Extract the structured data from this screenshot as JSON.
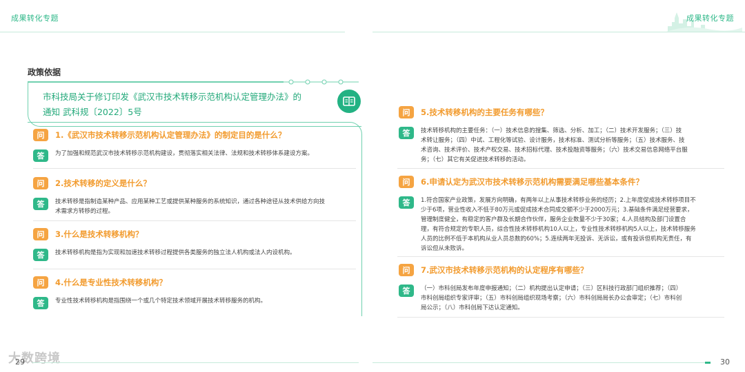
{
  "header": {
    "left_title": "成果转化专题",
    "right_title": "成果转化专题"
  },
  "section_title": "政策依据",
  "policy_title_lines": [
    "市科技局关于修订印发《武汉市技术转移示范机构认定管理办法》的",
    "通知 武科规〔2022〕5号"
  ],
  "badges": {
    "question": "问",
    "answer": "答"
  },
  "left_qa": [
    {
      "q": "1.《武汉市技术转移示范机构认定管理办法》的制定目的是什么？",
      "a": [
        "为了加强和规范武汉市技术转移示范机构建设，贯彻落实相关法律、法规和技术转移体系建设方案。"
      ]
    },
    {
      "q": "2.技术转移的定义是什么？",
      "a": [
        "技术转移是指制造某种产品、应用某种工艺或提供某种服务的系统知识，通过各种途径从技术供给方向技",
        "术需求方转移的过程。"
      ]
    },
    {
      "q": "3.什么是技术转移机构？",
      "a": [
        "技术转移机构是指为实现和加速技术转移过程提供各类服务的独立法人机构或法人内设机构。"
      ]
    },
    {
      "q": "4.什么是专业性技术转移机构？",
      "a": [
        "专业性技术转移机构是指围绕一个或几个特定技术领域开展技术转移服务的机构。"
      ]
    }
  ],
  "right_qa": [
    {
      "q": "5.技术转移机构的主要任务有哪些？",
      "a": [
        "技术转移机构的主要任务：（一）技术信息的搜集、筛选、分析、加工；（二）技术开发服务；（三）技",
        "术转让服务；（四）中试、工程化等试验、设计服务，技术标准、测试分析等服务；（五）技术服务、技",
        "术咨询、技术评价、技术产权交易、技术招标代理、技术投融资等服务；（六）技术交易信息网络平台服",
        "务；（七）其它有关促进技术转移的活动。"
      ]
    },
    {
      "q": "6.申请认定为武汉市技术转移示范机构需要满足哪些基本条件？",
      "a": [
        "1.符合国家产业政策，发展方向明确，有两年以上从事技术转移业务的经历；2.上年度促成技术转移项目不",
        "少于6项，营业性收入不低于80万元或促成技术合同成交额不少于2000万元；3.基础条件满足经营要求，",
        "管理制度健全，有稳定的客户群及长期合作伙伴，服务企业数量不少于30家；4.人员结构及部门设置合",
        "理，有符合规定的专职人员，综合性技术转移机构10人以上，专业性技术转移机构5人以上，技术转移服务",
        "人员的比例不低于本机构从业人员总数的60%；5.连续两年无投诉、无诉讼，或有投诉但机构无责任，有",
        "诉讼但从未败诉。"
      ]
    },
    {
      "q": "7.武汉市技术转移示范机构的认定程序有哪些？",
      "a": [
        "（一）市科创局发布年度申报通知；（二）机构提出认定申请；（三）区科技行政部门组织推荐；（四）",
        "市科创局组织专家评审；（五）市科创局组织现场考察；（六）市科创局局长办公会审定；（七）市科创",
        "局公示；（八）市科创局下达认定通知。"
      ]
    }
  ],
  "footer": {
    "left_page": "29",
    "right_page": "30",
    "watermark": "大数跨境"
  },
  "colors": {
    "accent_green": "#2fb889",
    "question_orange": "#f5a442",
    "question_text": "#f29b2e"
  }
}
